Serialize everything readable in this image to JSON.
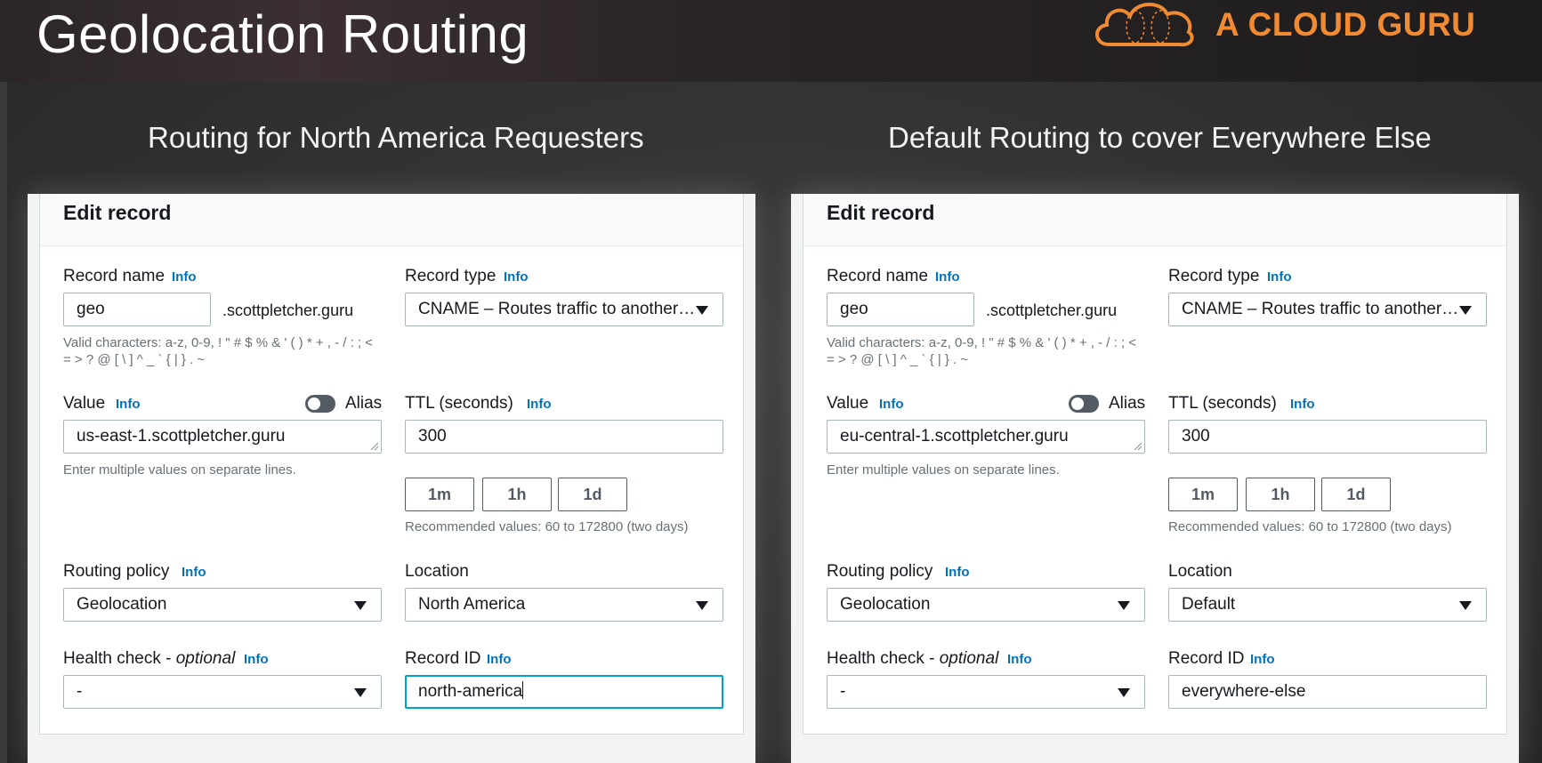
{
  "slide": {
    "title": "Geolocation Routing",
    "logo_text": "A CLOUD GURU",
    "brand_color": "#f08a33"
  },
  "panels": [
    {
      "heading": "Routing for North America Requesters",
      "edit_title": "Edit record",
      "record_name_label": "Record name",
      "record_name_info": "Info",
      "record_name_value": "geo",
      "domain_suffix": ".scottpletcher.guru",
      "valid_chars_help": "Valid characters: a-z, 0-9, ! \" # $ % & ' ( ) * + , - / : ; < = > ? @ [ \\ ] ^ _ ` { | } . ~",
      "record_type_label": "Record type",
      "record_type_info": "Info",
      "record_type_value": "CNAME – Routes traffic to another…",
      "value_label": "Value",
      "value_info": "Info",
      "alias_label": "Alias",
      "alias_enabled": false,
      "value_text": "us-east-1.scottpletcher.guru",
      "value_help": "Enter multiple values on separate lines.",
      "ttl_label": "TTL (seconds)",
      "ttl_info": "Info",
      "ttl_value": "300",
      "ttl_buttons": [
        "1m",
        "1h",
        "1d"
      ],
      "ttl_help": "Recommended values: 60 to 172800 (two days)",
      "routing_policy_label": "Routing policy",
      "routing_policy_info": "Info",
      "routing_policy_value": "Geolocation",
      "location_label": "Location",
      "location_value": "North America",
      "health_check_label": "Health check - ",
      "health_check_optional": "optional",
      "health_check_info": "Info",
      "health_check_value": "-",
      "record_id_label": "Record ID",
      "record_id_info": "Info",
      "record_id_value": "north-america"
    },
    {
      "heading": "Default Routing to cover Everywhere Else",
      "edit_title": "Edit record",
      "record_name_label": "Record name",
      "record_name_info": "Info",
      "record_name_value": "geo",
      "domain_suffix": ".scottpletcher.guru",
      "valid_chars_help": "Valid characters: a-z, 0-9, ! \" # $ % & ' ( ) * + , - / : ; < = > ? @ [ \\ ] ^ _ ` { | } . ~",
      "record_type_label": "Record type",
      "record_type_info": "Info",
      "record_type_value": "CNAME – Routes traffic to another…",
      "value_label": "Value",
      "value_info": "Info",
      "alias_label": "Alias",
      "alias_enabled": false,
      "value_text": "eu-central-1.scottpletcher.guru",
      "value_help": "Enter multiple values on separate lines.",
      "ttl_label": "TTL (seconds)",
      "ttl_info": "Info",
      "ttl_value": "300",
      "ttl_buttons": [
        "1m",
        "1h",
        "1d"
      ],
      "ttl_help": "Recommended values: 60 to 172800 (two days)",
      "routing_policy_label": "Routing policy",
      "routing_policy_info": "Info",
      "routing_policy_value": "Geolocation",
      "location_label": "Location",
      "location_value": "Default",
      "health_check_label": "Health check - ",
      "health_check_optional": "optional",
      "health_check_info": "Info",
      "health_check_value": "-",
      "record_id_label": "Record ID",
      "record_id_info": "Info",
      "record_id_value": "everywhere-else"
    }
  ]
}
